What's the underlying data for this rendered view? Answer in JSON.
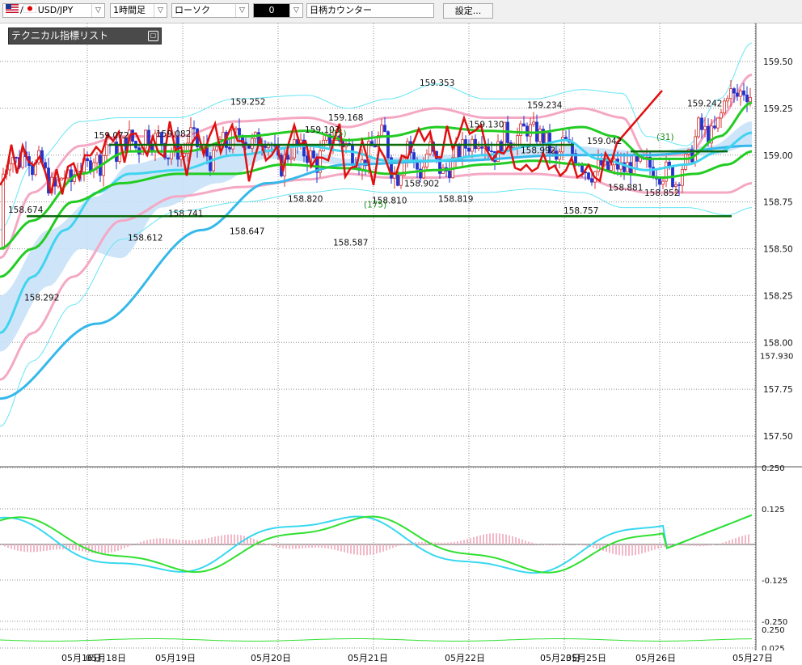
{
  "toolbar": {
    "symbol": "USD/JPY",
    "timeframe": "1時間足",
    "chart_style": "ローソク",
    "counter_value": "0",
    "counter_label": "日柄カウンター",
    "settings_label": "設定..."
  },
  "indicator_panel": {
    "title": "テクニカル指標リスト"
  },
  "colors": {
    "candle_up": "#d43030",
    "candle_down": "#2233cc",
    "close_line": "#e01010",
    "green_ma": "#22cc22",
    "bollinger_outer": "#66e6f5",
    "bollinger_inner": "#f4a8c4",
    "ichimoku_cloud": "#c9e2f8",
    "long_ma": "#35b8ea",
    "support_line": "#0b6b0b",
    "macd_line": "#38d8f0",
    "signal_line": "#30e030",
    "histogram": "#f2b8c8"
  },
  "chart_data": {
    "type": "line",
    "y_axis": {
      "ylim": [
        157.5,
        159.6
      ],
      "tick_labels": [
        "159.50",
        "159.25",
        "159.00",
        "158.75",
        "158.50",
        "158.25",
        "158.00",
        "157.75",
        "157.50"
      ],
      "extra_label": "157.930"
    },
    "x_axis": {
      "tick_labels": [
        "05月16日",
        "05月18日",
        "05月19日",
        "05月20日",
        "05月21日",
        "05月22日",
        "05月23日",
        "05月25日",
        "05月26日",
        "05月27日"
      ]
    },
    "price_annotations": [
      {
        "label": "158.674",
        "value": 158.674
      },
      {
        "label": "158.292",
        "value": 158.292
      },
      {
        "label": "159.072",
        "value": 159.072
      },
      {
        "label": "158.612",
        "value": 158.612
      },
      {
        "label": "159.082",
        "value": 159.082
      },
      {
        "label": "158.741",
        "value": 158.741
      },
      {
        "label": "159.252",
        "value": 159.252
      },
      {
        "label": "158.647",
        "value": 158.647
      },
      {
        "label": "159.103",
        "value": 159.103
      },
      {
        "label": "158.820",
        "value": 158.82
      },
      {
        "label": "159.168",
        "value": 159.168
      },
      {
        "label": "158.587",
        "value": 158.587
      },
      {
        "label": "158.810",
        "value": 158.81
      },
      {
        "label": "158.902",
        "value": 158.902
      },
      {
        "label": "159.353",
        "value": 159.353
      },
      {
        "label": "158.819",
        "value": 158.819
      },
      {
        "label": "159.130",
        "value": 159.13
      },
      {
        "label": "159.234",
        "value": 159.234
      },
      {
        "label": "158.992",
        "value": 158.992
      },
      {
        "label": "159.042",
        "value": 159.042
      },
      {
        "label": "158.757",
        "value": 158.757
      },
      {
        "label": "158.881",
        "value": 158.881
      },
      {
        "label": "158.852",
        "value": 158.852
      },
      {
        "label": "159.242",
        "value": 159.242
      }
    ],
    "counter_annotations": [
      "(15)",
      "(175)",
      "(31)"
    ],
    "horizontal_lines": [
      159.055,
      158.674
    ],
    "series": [
      {
        "name": "",
        "values": [
          158.9,
          159.02,
          158.95,
          159.05,
          158.92,
          158.98,
          158.85,
          158.82,
          158.9,
          158.85,
          158.95,
          158.92,
          159.0,
          158.95,
          159.08,
          159.0,
          159.05,
          159.1,
          159.02,
          159.12,
          159.08,
          159.1,
          159.0,
          159.05,
          158.98,
          159.12,
          159.05,
          159.02,
          158.95,
          159.08,
          159.05,
          159.1,
          159.12,
          159.05,
          159.08,
          159.1,
          159.05,
          158.92,
          159.0,
          159.05,
          159.02,
          159.0,
          158.95,
          159.05,
          159.1,
          159.08,
          159.05,
          159.0,
          158.95,
          159.02,
          159.08,
          159.12,
          158.92,
          158.88,
          159.1,
          158.95,
          158.9,
          159.05,
          158.95,
          158.9,
          158.95,
          159.02,
          159.05,
          159.08,
          159.1,
          159.05,
          159.0,
          159.12,
          159.08,
          159.1,
          159.15,
          159.12,
          159.1,
          159.05,
          158.95,
          159.08,
          159.02,
          158.98,
          158.92,
          158.9,
          158.95,
          158.92,
          158.95,
          158.92,
          158.95,
          158.93,
          158.95,
          158.93,
          158.9,
          158.92,
          158.85,
          158.95,
          158.98,
          159.15,
          159.12,
          159.1,
          159.2,
          159.35,
          159.3,
          159.35,
          159.32
        ]
      }
    ]
  }
}
